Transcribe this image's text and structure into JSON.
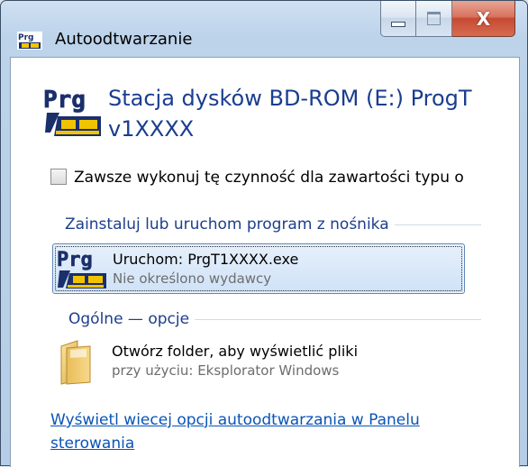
{
  "window": {
    "title": "Autoodtwarzanie",
    "close_glyph": "X",
    "caption_buttons": [
      "minimize-icon",
      "maximize-icon",
      "close-icon"
    ]
  },
  "header": {
    "drive_title": "Stacja dysków BD-ROM (E:) ProgT v1XXXX",
    "drive_icon": "progt-app-icon"
  },
  "always_checkbox": {
    "label": "Zawsze wykonuj tę czynność dla zawartości typu o",
    "checked": false
  },
  "groups": [
    {
      "header": "Zainstaluj lub uruchom program z nośnika",
      "options": [
        {
          "title": "Uruchom: PrgT1XXXX.exe",
          "subtitle": "Nie określono wydawcy",
          "icon": "progt-app-icon",
          "selected": true
        }
      ]
    },
    {
      "header": "Ogólne — opcje",
      "options": [
        {
          "title": "Otwórz folder, aby wyświetlić pliki",
          "subtitle": "przy użyciu: Eksplorator Windows",
          "icon": "folder-icon",
          "selected": false
        }
      ]
    }
  ],
  "footer_link": "Wyświetl wiecej opcji autoodtwarzania w Panelu sterowania",
  "colors": {
    "accent_text": "#1a3d8f",
    "link": "#0a54b8",
    "selection_border": "#5e86b5",
    "close_button": "#c74a32"
  }
}
